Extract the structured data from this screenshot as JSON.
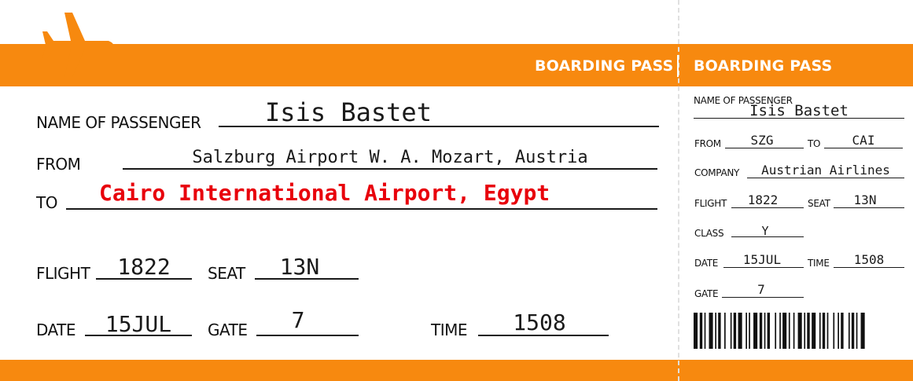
{
  "brand": {
    "accent": "#f7890f",
    "red_text": "#e8000b"
  },
  "header": {
    "main_title": "BOARDING PASS",
    "stub_title": "BOARDING PASS",
    "icon": "airplane-icon"
  },
  "main": {
    "passenger_label": "NAME OF PASSENGER",
    "passenger_value": "Isis Bastet",
    "from_label": "FROM",
    "from_value": "Salzburg Airport W. A. Mozart, Austria",
    "to_label": "TO",
    "to_value": "Cairo International Airport, Egypt",
    "flight_label": "FLIGHT",
    "flight_value": "1822",
    "seat_label": "SEAT",
    "seat_value": "13N",
    "date_label": "DATE",
    "date_value": "15JUL",
    "gate_label": "GATE",
    "gate_value": "7",
    "time_label": "TIME",
    "time_value": "1508"
  },
  "stub": {
    "passenger_label": "NAME OF PASSENGER",
    "passenger_value": "Isis Bastet",
    "from_label": "FROM",
    "from_value": "SZG",
    "to_label": "TO",
    "to_value": "CAI",
    "company_label": "COMPANY",
    "company_value": "Austrian Airlines",
    "flight_label": "FLIGHT",
    "flight_value": "1822",
    "seat_label": "SEAT",
    "seat_value": "13N",
    "class_label": "CLASS",
    "class_value": "Y",
    "date_label": "DATE",
    "date_value": "15JUL",
    "time_label": "TIME",
    "time_value": "1508",
    "gate_label": "GATE",
    "gate_value": "7",
    "barcode_icon": "barcode-icon"
  }
}
